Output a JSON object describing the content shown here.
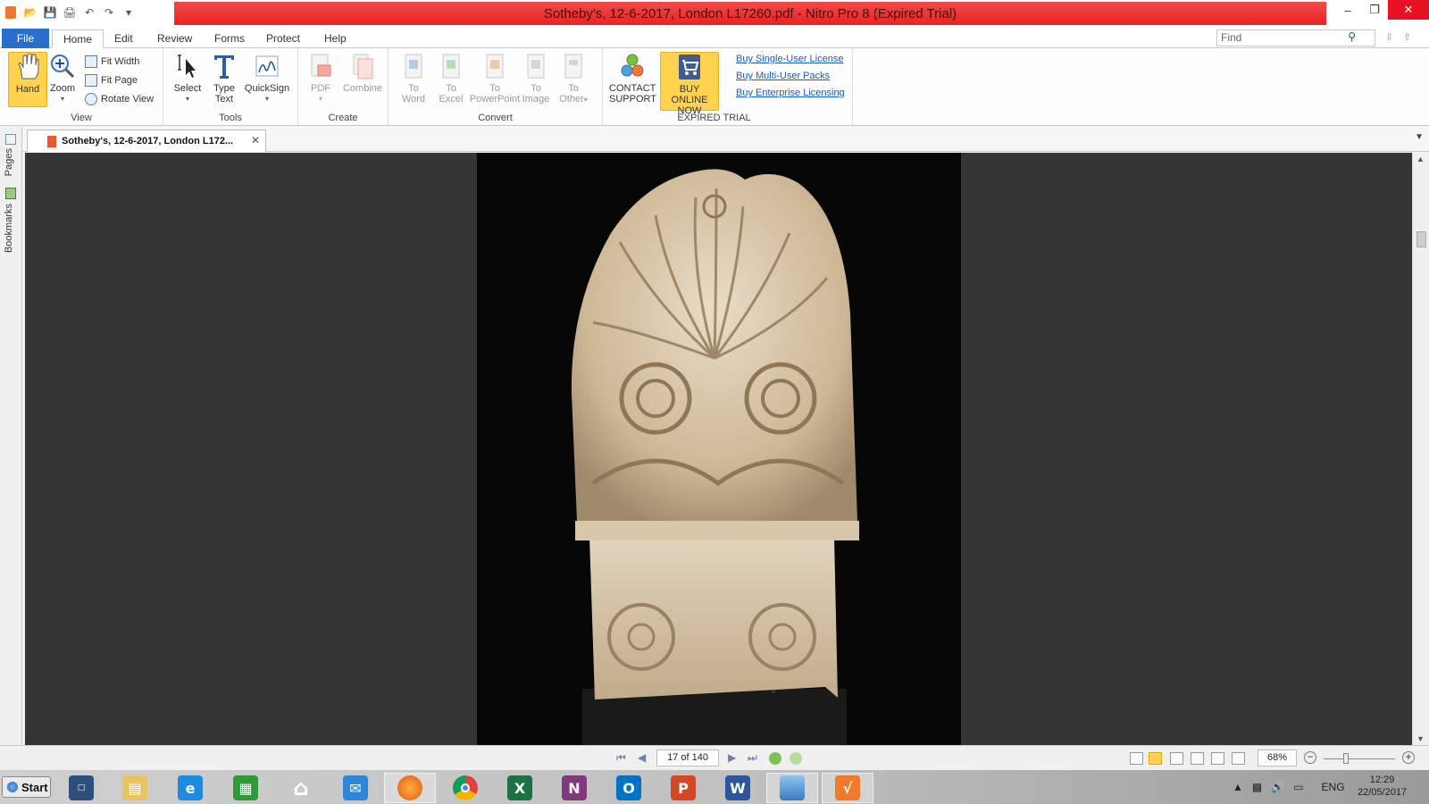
{
  "window": {
    "title": "Sotheby's, 12-6-2017, London L17260.pdf - Nitro Pro 8 (Expired Trial)",
    "minimize_label": "–",
    "restore_label": "❐",
    "close_label": "✕"
  },
  "menu": {
    "file": "File",
    "tabs": [
      "Home",
      "Edit",
      "Review",
      "Forms",
      "Protect",
      "Help"
    ],
    "find_placeholder": "Find"
  },
  "ribbon": {
    "view": {
      "group_label": "View",
      "hand": "Hand",
      "zoom": "Zoom",
      "fit_width": "Fit Width",
      "fit_page": "Fit Page",
      "rotate_view": "Rotate View"
    },
    "tools": {
      "group_label": "Tools",
      "select": "Select",
      "type_text_1": "Type",
      "type_text_2": "Text",
      "quicksign": "QuickSign"
    },
    "create": {
      "group_label": "Create",
      "pdf": "PDF",
      "combine": "Combine"
    },
    "convert": {
      "group_label": "Convert",
      "buttons": [
        {
          "l1": "To",
          "l2": "Word"
        },
        {
          "l1": "To",
          "l2": "Excel"
        },
        {
          "l1": "To",
          "l2": "PowerPoint"
        },
        {
          "l1": "To",
          "l2": "Image"
        },
        {
          "l1": "To",
          "l2": "Other"
        }
      ]
    },
    "trial": {
      "group_label": "EXPIRED TRIAL",
      "contact_1": "CONTACT",
      "contact_2": "SUPPORT",
      "buy_1": "BUY ONLINE",
      "buy_2": "NOW",
      "links": [
        "Buy Single-User License",
        "Buy Multi-User Packs",
        "Buy Enterprise Licensing"
      ]
    }
  },
  "sidepanel": {
    "pages": "Pages",
    "bookmarks": "Bookmarks"
  },
  "document_tab": {
    "label": "Sotheby's, 12-6-2017, London L172..."
  },
  "status": {
    "page_indicator": "17 of 140",
    "zoom": "68%"
  },
  "taskbar": {
    "start": "Start",
    "language": "ENG",
    "time": "12:29",
    "date": "22/05/2017"
  },
  "colors": {
    "title_bar": "#ee2c2c",
    "file_tab": "#2a6ecb",
    "highlight": "#ffd350",
    "viewer_bg": "#353535"
  }
}
